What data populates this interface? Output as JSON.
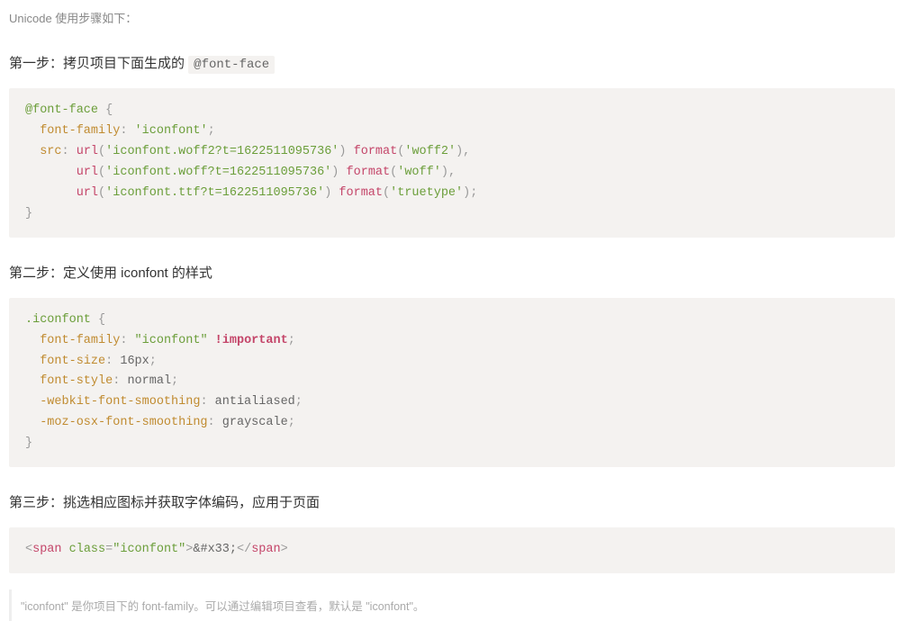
{
  "intro": "Unicode 使用步骤如下：",
  "step1": {
    "prefix": "第一步：拷贝项目下面生成的 ",
    "inline": "@font-face",
    "code_html": "<span class='tok-sel'>@font-face</span> <span class='tok-punct'>{</span>\n  <span class='tok-prop'>font-family</span><span class='tok-punct'>:</span> <span class='tok-str'>'iconfont'</span><span class='tok-punct'>;</span>\n  <span class='tok-prop'>src</span><span class='tok-punct'>:</span> <span class='tok-func'>url</span><span class='tok-punct'>(</span><span class='tok-str'>'iconfont.woff2?t=1622511095736'</span><span class='tok-punct'>)</span> <span class='tok-func'>format</span><span class='tok-punct'>(</span><span class='tok-str'>'woff2'</span><span class='tok-punct'>),</span>\n       <span class='tok-func'>url</span><span class='tok-punct'>(</span><span class='tok-str'>'iconfont.woff?t=1622511095736'</span><span class='tok-punct'>)</span> <span class='tok-func'>format</span><span class='tok-punct'>(</span><span class='tok-str'>'woff'</span><span class='tok-punct'>),</span>\n       <span class='tok-func'>url</span><span class='tok-punct'>(</span><span class='tok-str'>'iconfont.ttf?t=1622511095736'</span><span class='tok-punct'>)</span> <span class='tok-func'>format</span><span class='tok-punct'>(</span><span class='tok-str'>'truetype'</span><span class='tok-punct'>);</span>\n<span class='tok-punct'>}</span>"
  },
  "step2": {
    "heading": "第二步：定义使用 iconfont 的样式",
    "code_html": "<span class='tok-sel'>.iconfont</span> <span class='tok-punct'>{</span>\n  <span class='tok-prop'>font-family</span><span class='tok-punct'>:</span> <span class='tok-str'>\"iconfont\"</span> <span class='tok-imp'>!important</span><span class='tok-punct'>;</span>\n  <span class='tok-prop'>font-size</span><span class='tok-punct'>:</span> <span class='tok-val'>16px</span><span class='tok-punct'>;</span>\n  <span class='tok-prop'>font-style</span><span class='tok-punct'>:</span> <span class='tok-val'>normal</span><span class='tok-punct'>;</span>\n  <span class='tok-prop'>-webkit-font-smoothing</span><span class='tok-punct'>:</span> <span class='tok-val'>antialiased</span><span class='tok-punct'>;</span>\n  <span class='tok-prop'>-moz-osx-font-smoothing</span><span class='tok-punct'>:</span> <span class='tok-val'>grayscale</span><span class='tok-punct'>;</span>\n<span class='tok-punct'>}</span>"
  },
  "step3": {
    "heading": "第三步：挑选相应图标并获取字体编码，应用于页面",
    "code_html": "<span class='tok-punct'>&lt;</span><span class='tok-tag'>span</span> <span class='tok-attr'>class</span><span class='tok-punct'>=</span><span class='tok-str'>\"iconfont\"</span><span class='tok-punct'>&gt;</span><span class='tok-plain'>&amp;#x33;</span><span class='tok-punct'>&lt;/</span><span class='tok-tag'>span</span><span class='tok-punct'>&gt;</span>"
  },
  "note": "\"iconfont\" 是你项目下的 font-family。可以通过编辑项目查看，默认是 \"iconfont\"。"
}
